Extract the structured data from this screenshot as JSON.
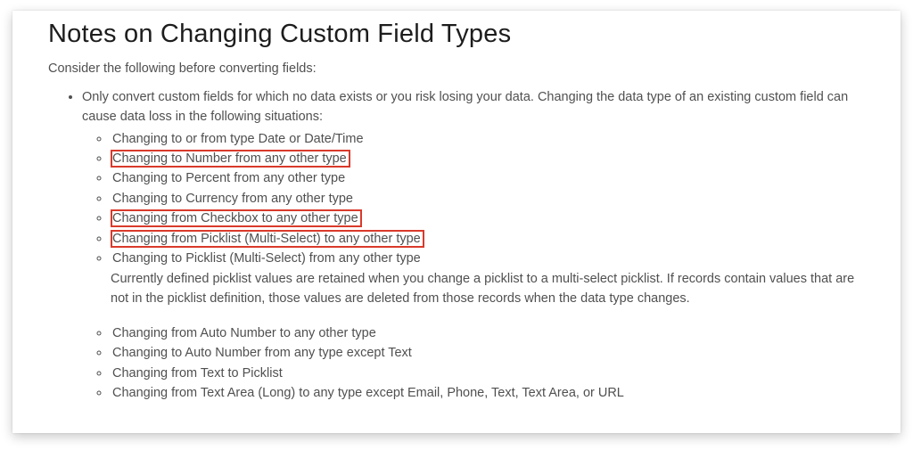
{
  "title": "Notes on Changing Custom Field Types",
  "intro": "Consider the following before converting fields:",
  "main_point": "Only convert custom fields for which no data exists or you risk losing your data. Changing the data type of an existing custom field can cause data loss in the following situations:",
  "items": {
    "i0": "Changing to or from type Date or Date/Time",
    "i1": "Changing to Number from any other type",
    "i2": "Changing to Percent from any other type",
    "i3": "Changing to Currency from any other type",
    "i4": "Changing from Checkbox to any other type",
    "i5": "Changing from Picklist (Multi-Select) to any other type",
    "i6": "Changing to Picklist (Multi-Select) from any other type",
    "i6_extra": "Currently defined picklist values are retained when you change a picklist to a multi-select picklist. If records contain values that are not in the picklist definition, those values are deleted from those records when the data type changes.",
    "i7": "Changing from Auto Number to any other type",
    "i8": "Changing to Auto Number from any type except Text",
    "i9": "Changing from Text to Picklist",
    "i10": "Changing from Text Area (Long) to any type except Email, Phone, Text, Text Area, or URL"
  }
}
